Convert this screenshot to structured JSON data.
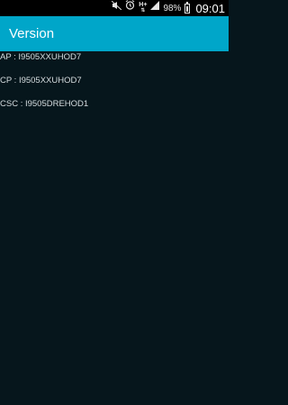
{
  "status_bar": {
    "battery_percent": "98%",
    "time": "09:01",
    "network_type": "H+",
    "icons": [
      "mute-icon",
      "alarm-icon",
      "network-icon",
      "signal-icon",
      "battery-icon"
    ]
  },
  "app_bar": {
    "title": "Version",
    "color": "#00a6c9"
  },
  "versions": [
    {
      "text": "AP : I9505XXUHOD7"
    },
    {
      "text": "CP : I9505XXUHOD7"
    },
    {
      "text": "CSC : I9505DREHOD1"
    }
  ]
}
